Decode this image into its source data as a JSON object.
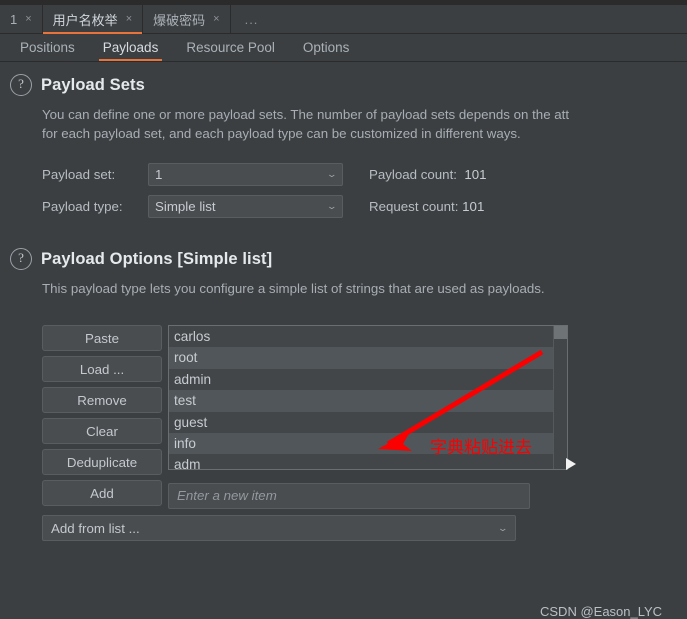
{
  "window": {
    "tabs": [
      {
        "label": "1",
        "closable": true,
        "active": false
      },
      {
        "label": "用户名枚举",
        "closable": true,
        "active": true
      },
      {
        "label": "爆破密码",
        "closable": true,
        "active": false
      },
      {
        "label": "...",
        "closable": false,
        "active": false
      }
    ],
    "close_glyph": "×"
  },
  "subtabs": [
    {
      "label": "Positions",
      "active": false
    },
    {
      "label": "Payloads",
      "active": true
    },
    {
      "label": "Resource Pool",
      "active": false
    },
    {
      "label": "Options",
      "active": false
    }
  ],
  "payload_sets": {
    "help_glyph": "?",
    "title": "Payload Sets",
    "description_line1": "You can define one or more payload sets. The number of payload sets depends on the att",
    "description_line2": "for each payload set, and each payload type can be customized in different ways.",
    "payload_set_label": "Payload set:",
    "payload_set_value": "1",
    "payload_type_label": "Payload type:",
    "payload_type_value": "Simple list",
    "payload_count_label": "Payload count:",
    "payload_count_value": "101",
    "request_count_label": "Request count:",
    "request_count_value": "101",
    "chevron_glyph": "⌄"
  },
  "payload_options": {
    "help_glyph": "?",
    "title": "Payload Options [Simple list]",
    "description": "This payload type lets you configure a simple list of strings that are used as payloads.",
    "buttons": [
      {
        "label": "Paste"
      },
      {
        "label": "Load ..."
      },
      {
        "label": "Remove"
      },
      {
        "label": "Clear"
      },
      {
        "label": "Deduplicate"
      },
      {
        "label": "Add"
      }
    ],
    "list_items": [
      "carlos",
      "root",
      "admin",
      "test",
      "guest",
      "info",
      "adm"
    ],
    "new_item_placeholder": "Enter a new item",
    "new_item_value": "",
    "add_from_list_label": "Add from list ...",
    "chevron_glyph": "⌄"
  },
  "annotation": {
    "text": "字典粘贴进去",
    "color": "#fb0000"
  },
  "watermark": "CSDN @Eason_LYC",
  "theme": {
    "background": "#3c3f41",
    "accent": "#e8743b",
    "panel": "#4a4d4f",
    "list_odd": "#434648",
    "list_even": "#51565a",
    "text": "#bbbbbb"
  }
}
